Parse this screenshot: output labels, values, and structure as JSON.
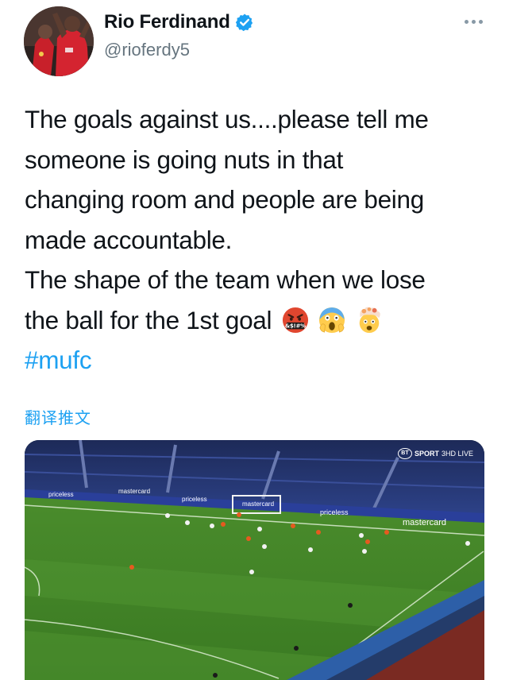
{
  "author": {
    "display_name": "Rio Ferdinand",
    "handle": "@rioferdy5",
    "verified": true,
    "avatar_icon": "profile-photo"
  },
  "tweet": {
    "lines": [
      "The goals against us....please tell me",
      "someone is going nuts in that",
      "changing room and people are being",
      "made accountable.",
      "The shape of the team when we lose",
      "the ball for the 1st goal"
    ],
    "emojis": [
      "face-with-symbols-on-mouth",
      "face-screaming-in-fear",
      "exploding-head"
    ],
    "hashtag": "#mufc"
  },
  "translate_label": "翻译推文",
  "media": {
    "broadcaster": "SPORT",
    "channel": "3HD LIVE",
    "boards": [
      "priceless",
      "mastercard",
      "priceless",
      "mastercard",
      "priceless",
      "mastercard"
    ]
  },
  "colors": {
    "link": "#1da1f2",
    "verified": "#1da1f2",
    "secondary_text": "#66757f"
  }
}
